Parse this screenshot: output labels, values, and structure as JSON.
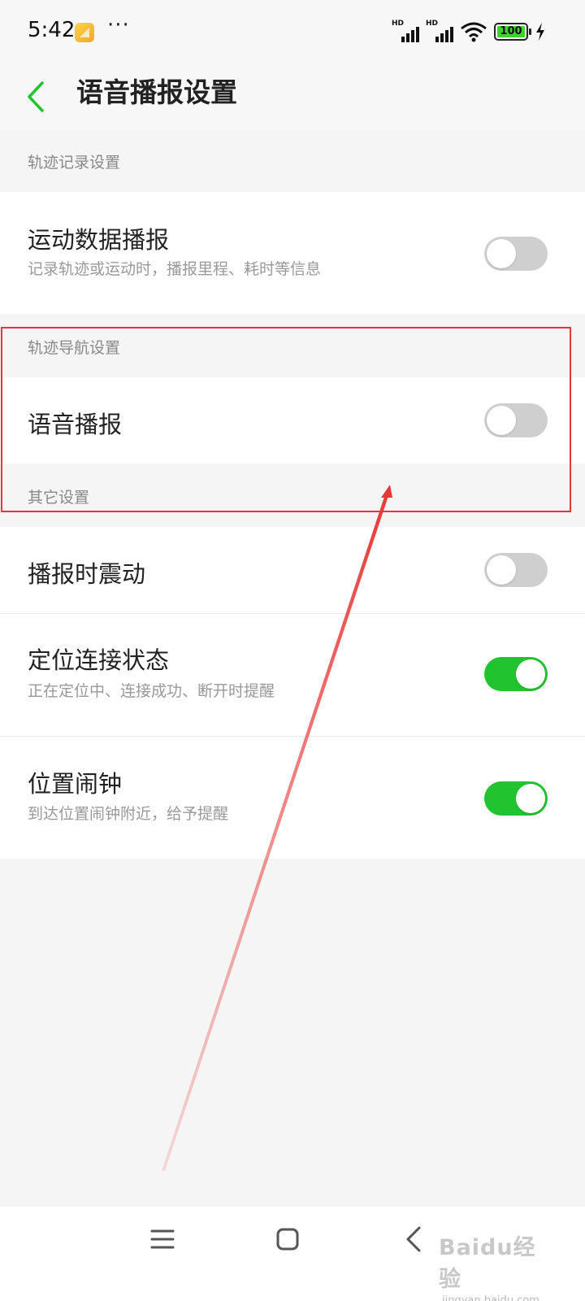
{
  "status_bar": {
    "time": "5:42",
    "more": "···",
    "signal_label_1": "HD",
    "signal_label_2": "HD",
    "battery_level": "100",
    "icons": [
      "notification-app-icon",
      "signal-icon",
      "signal-icon",
      "wifi-icon",
      "battery-icon",
      "charging-icon"
    ]
  },
  "header": {
    "back_icon": "chevron-left-icon",
    "title": "语音播报设置"
  },
  "sections": [
    {
      "title": "轨迹记录设置",
      "items": [
        {
          "title": "运动数据播报",
          "description": "记录轨迹或运动时，播报里程、耗时等信息",
          "enabled": false
        }
      ]
    },
    {
      "title": "轨迹导航设置",
      "items": [
        {
          "title": "语音播报",
          "description": "",
          "enabled": false
        }
      ]
    },
    {
      "title": "其它设置",
      "items": [
        {
          "title": "播报时震动",
          "description": "",
          "enabled": false
        },
        {
          "title": "定位连接状态",
          "description": "正在定位中、连接成功、断开时提醒",
          "enabled": true
        },
        {
          "title": "位置闹钟",
          "description": "到达位置闹钟附近，给予提醒",
          "enabled": true
        }
      ]
    }
  ],
  "colors": {
    "accent": "#21c42e",
    "toggle_off": "#cfcfcf",
    "annotation": "#e53935"
  },
  "nav_bar": {
    "icons": [
      "menu-icon",
      "home-icon",
      "back-icon"
    ]
  },
  "watermark": {
    "logo": "Baidu经验",
    "site": "jingyan.baidu.com"
  }
}
